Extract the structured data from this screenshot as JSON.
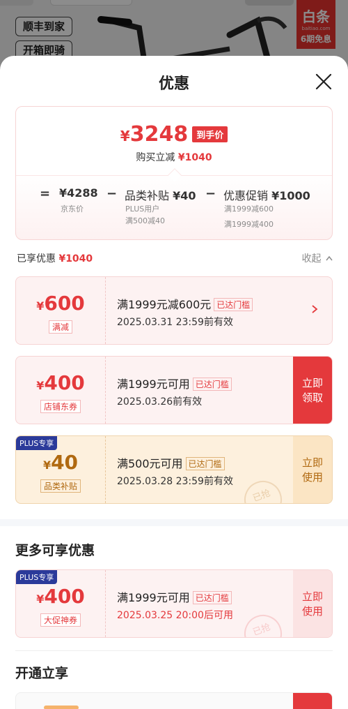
{
  "background": {
    "tag1": "顺丰到家",
    "tag2": "开箱即骑",
    "baitiao_title": "白条",
    "baitiao_domain": "baitiao.com",
    "baitiao_promo": "6期免息"
  },
  "sheet": {
    "title": "优惠"
  },
  "summary": {
    "price_yen": "¥",
    "price": "3248",
    "price_badge": "到手价",
    "sub_label": "购买立减",
    "sub_amount": "¥1040",
    "eq": "=",
    "jd_price": "¥4288",
    "jd_price_label": "京东价",
    "minus1": "−",
    "category_label": "品类补贴",
    "category_amount": "¥40",
    "category_sub1": "PLUS用户",
    "category_sub2": "满500减40",
    "minus2": "−",
    "promo_label": "优惠促销",
    "promo_amount": "¥1000",
    "promo_sub1": "满1999减600",
    "promo_sub2": "满1999减400"
  },
  "enjoyed": {
    "label": "已享优惠",
    "amount": "¥1040",
    "collapse": "收起"
  },
  "coupons": [
    {
      "yen": "¥",
      "amount": "600",
      "type": "满减",
      "condition": "满1999元减600元",
      "tag": "已达门槛",
      "validity": "2025.03.31 23:59前有效"
    },
    {
      "yen": "¥",
      "amount": "400",
      "type": "店铺东券",
      "condition": "满1999元可用",
      "tag": "已达门槛",
      "validity": "2025.03.26前有效",
      "action": "立即领取"
    },
    {
      "badge": "PLUS专享",
      "yen": "¥",
      "amount": "40",
      "type": "品类补贴",
      "condition": "满500元可用",
      "tag": "已达门槛",
      "validity": "2025.03.28 23:59前有效",
      "action": "立即使用",
      "stamp": "已抢"
    }
  ],
  "more": {
    "title": "更多可享优惠",
    "coupon": {
      "badge": "PLUS专享",
      "yen": "¥",
      "amount": "400",
      "type": "大促神券",
      "condition": "满1999元可用",
      "tag": "已达门槛",
      "validity": "2025.03.25 20:00后可用",
      "action": "立即使用",
      "stamp": "已抢"
    }
  },
  "open": {
    "title": "开通立享"
  },
  "colors": {
    "accent_red": "#e4393c",
    "gold": "#b06910",
    "plus_blue": "#2b3a9a"
  }
}
